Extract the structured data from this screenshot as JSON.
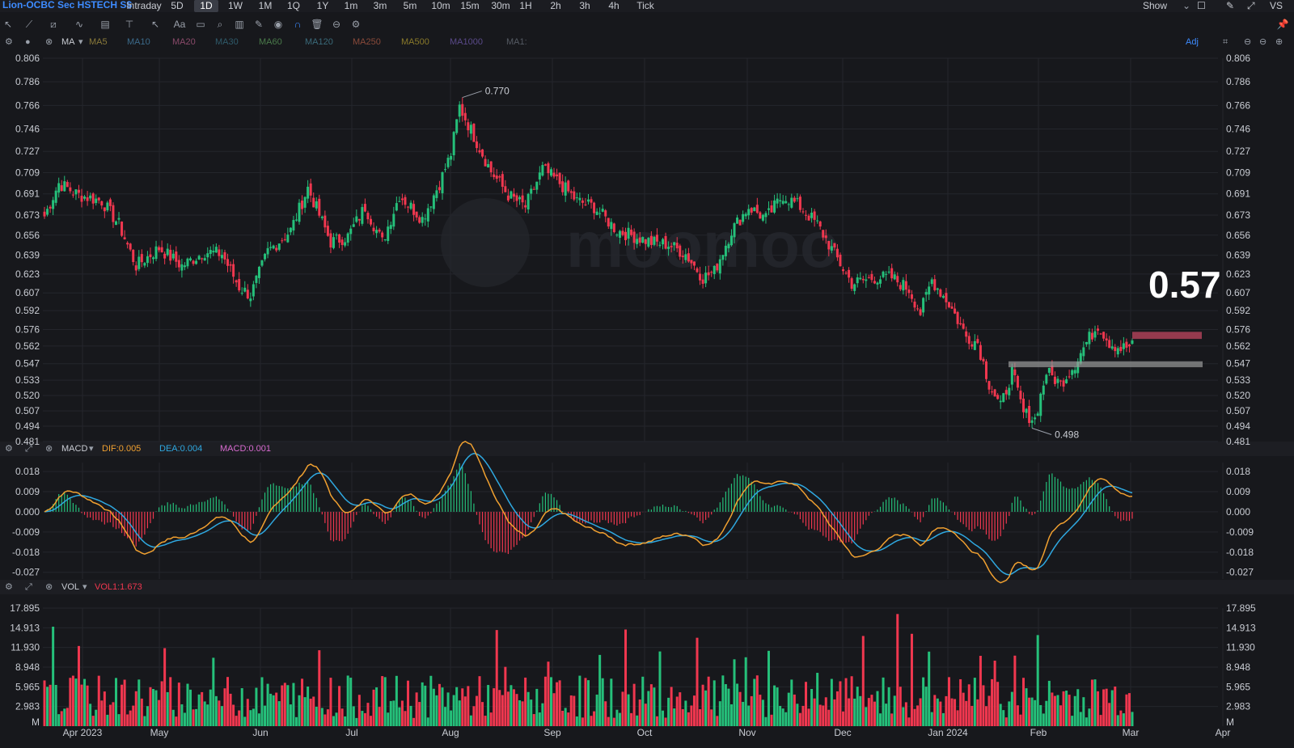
{
  "header": {
    "symbol": "Lion-OCBC Sec HSTECH S$",
    "timeframes": [
      "Intraday",
      "5D",
      "1D",
      "1W",
      "1M",
      "1Q",
      "1Y",
      "1m",
      "3m",
      "5m",
      "10m",
      "15m",
      "30m",
      "1H",
      "2h",
      "3h",
      "4h",
      "Tick"
    ],
    "active_timeframe": "1D",
    "show_label": "Show",
    "vs_label": "VS",
    "adj_label": "Adj"
  },
  "ma_bar": {
    "label": "MA",
    "items": [
      {
        "label": "MA5",
        "color": "#8a7a3a"
      },
      {
        "label": "MA10",
        "color": "#3b6a8a"
      },
      {
        "label": "MA20",
        "color": "#8a4a6a"
      },
      {
        "label": "MA30",
        "color": "#2f5a6a"
      },
      {
        "label": "MA60",
        "color": "#4a7a4a"
      },
      {
        "label": "MA120",
        "color": "#3a6a7a"
      },
      {
        "label": "MA250",
        "color": "#8a4a3a"
      },
      {
        "label": "MA500",
        "color": "#8a7a2a"
      },
      {
        "label": "MA1000",
        "color": "#5a4a8a"
      },
      {
        "label": "MA1:",
        "color": "#555a63"
      }
    ]
  },
  "macd_bar": {
    "label": "MACD",
    "dif": "DIF:0.005",
    "dea": "DEA:0.004",
    "macd": "MACD:0.001",
    "dif_color": "#f0a030",
    "dea_color": "#2fa8e0",
    "macd_color": "#d86bd0"
  },
  "vol_bar": {
    "label": "VOL",
    "vol1": "VOL1:1.673"
  },
  "colors": {
    "up": "#25c07a",
    "down": "#f0374f",
    "dif_line": "#f0a030",
    "dea_line": "#2fa8e0",
    "grid": "#24262c",
    "bg": "#17181c"
  },
  "chart_data": [
    {
      "type": "candlestick",
      "title": "Lion-OCBC Sec HSTECH S$ (1D)",
      "yticks": [
        "0.806",
        "0.786",
        "0.766",
        "0.746",
        "0.727",
        "0.709",
        "0.691",
        "0.673",
        "0.656",
        "0.639",
        "0.623",
        "0.607",
        "0.592",
        "0.576",
        "0.562",
        "0.547",
        "0.533",
        "0.520",
        "0.507",
        "0.494",
        "0.481"
      ],
      "ylim": [
        0.481,
        0.806
      ],
      "x_month_labels": [
        "Apr 2023",
        "May",
        "Jun",
        "Jul",
        "Aug",
        "Sep",
        "Oct",
        "Nov",
        "Dec",
        "Jan 2024",
        "Feb",
        "Mar",
        "Apr"
      ],
      "annotations": {
        "high": "0.770",
        "low": "0.498",
        "current_price_label": "0.57"
      },
      "levels": [
        {
          "name": "resistance",
          "value": 0.57,
          "color": "#c0455f"
        },
        {
          "name": "support",
          "value": 0.547,
          "color": "#9a9a9a"
        }
      ],
      "close_anchors": [
        {
          "day": 0,
          "close": 0.672
        },
        {
          "day": 5,
          "close": 0.7
        },
        {
          "day": 12,
          "close": 0.69
        },
        {
          "day": 20,
          "close": 0.685
        },
        {
          "day": 26,
          "close": 0.665
        },
        {
          "day": 32,
          "close": 0.63
        },
        {
          "day": 40,
          "close": 0.645
        },
        {
          "day": 48,
          "close": 0.63
        },
        {
          "day": 56,
          "close": 0.642
        },
        {
          "day": 62,
          "close": 0.64
        },
        {
          "day": 68,
          "close": 0.612
        },
        {
          "day": 72,
          "close": 0.605
        },
        {
          "day": 78,
          "close": 0.642
        },
        {
          "day": 86,
          "close": 0.66
        },
        {
          "day": 92,
          "close": 0.696
        },
        {
          "day": 100,
          "close": 0.65
        },
        {
          "day": 106,
          "close": 0.655
        },
        {
          "day": 112,
          "close": 0.68
        },
        {
          "day": 118,
          "close": 0.65
        },
        {
          "day": 124,
          "close": 0.69
        },
        {
          "day": 132,
          "close": 0.67
        },
        {
          "day": 138,
          "close": 0.7
        },
        {
          "day": 142,
          "close": 0.725
        },
        {
          "day": 145,
          "close": 0.765
        },
        {
          "day": 150,
          "close": 0.74
        },
        {
          "day": 156,
          "close": 0.71
        },
        {
          "day": 162,
          "close": 0.69
        },
        {
          "day": 168,
          "close": 0.68
        },
        {
          "day": 174,
          "close": 0.712
        },
        {
          "day": 180,
          "close": 0.7
        },
        {
          "day": 186,
          "close": 0.685
        },
        {
          "day": 192,
          "close": 0.68
        },
        {
          "day": 200,
          "close": 0.66
        },
        {
          "day": 206,
          "close": 0.655
        },
        {
          "day": 212,
          "close": 0.65
        },
        {
          "day": 218,
          "close": 0.648
        },
        {
          "day": 224,
          "close": 0.64
        },
        {
          "day": 230,
          "close": 0.62
        },
        {
          "day": 234,
          "close": 0.625
        },
        {
          "day": 240,
          "close": 0.66
        },
        {
          "day": 246,
          "close": 0.68
        },
        {
          "day": 252,
          "close": 0.67
        },
        {
          "day": 258,
          "close": 0.69
        },
        {
          "day": 264,
          "close": 0.68
        },
        {
          "day": 270,
          "close": 0.665
        },
        {
          "day": 276,
          "close": 0.64
        },
        {
          "day": 282,
          "close": 0.615
        },
        {
          "day": 290,
          "close": 0.62
        },
        {
          "day": 296,
          "close": 0.62
        },
        {
          "day": 302,
          "close": 0.61
        },
        {
          "day": 306,
          "close": 0.59
        },
        {
          "day": 310,
          "close": 0.618
        },
        {
          "day": 316,
          "close": 0.598
        },
        {
          "day": 322,
          "close": 0.57
        },
        {
          "day": 326,
          "close": 0.565
        },
        {
          "day": 330,
          "close": 0.53
        },
        {
          "day": 334,
          "close": 0.51
        },
        {
          "day": 338,
          "close": 0.54
        },
        {
          "day": 342,
          "close": 0.505
        },
        {
          "day": 346,
          "close": 0.5
        },
        {
          "day": 350,
          "close": 0.54
        },
        {
          "day": 355,
          "close": 0.53
        },
        {
          "day": 360,
          "close": 0.547
        },
        {
          "day": 364,
          "close": 0.565
        },
        {
          "day": 368,
          "close": 0.58
        },
        {
          "day": 372,
          "close": 0.565
        },
        {
          "day": 376,
          "close": 0.56
        },
        {
          "day": 380,
          "close": 0.562
        }
      ]
    },
    {
      "type": "line",
      "title": "MACD",
      "yticks": [
        "0.018",
        "0.009",
        "0.000",
        "-0.009",
        "-0.018",
        "-0.027"
      ],
      "ylim": [
        -0.03,
        0.022
      ],
      "series": [
        {
          "name": "DIF",
          "color": "#f0a030"
        },
        {
          "name": "DEA",
          "color": "#2fa8e0"
        },
        {
          "name": "MACD",
          "color": "#d86bd0"
        }
      ]
    },
    {
      "type": "bar",
      "title": "VOL",
      "yticks": [
        "17.895",
        "14.913",
        "11.930",
        "8.948",
        "5.965",
        "2.983",
        "M"
      ],
      "ylim": [
        0,
        17.895
      ],
      "unit": "M"
    }
  ]
}
